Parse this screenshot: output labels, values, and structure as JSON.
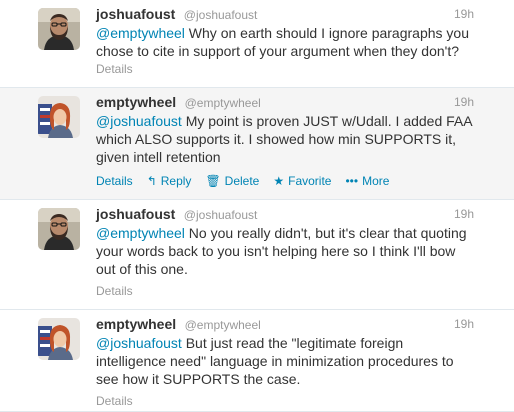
{
  "tweets": [
    {
      "fullname": "joshuafoust",
      "handle": "@joshuafoust",
      "time": "19h",
      "mention": "@emptywheel",
      "text": " Why on earth should I ignore paragraphs you\nchose to cite in support of your argument when they don't?",
      "details": "Details",
      "avatar": "bearded-man-glasses"
    },
    {
      "fullname": "emptywheel",
      "handle": "@emptywheel",
      "time": "19h",
      "mention": "@joshuafoust",
      "text": " My point is proven JUST w/Udall. I added FAA\nwhich ALSO supports it. I showed how min SUPPORTS it,\ngiven intell retention",
      "details": "Details",
      "actions": {
        "reply": "Reply",
        "delete": "Delete",
        "favorite": "Favorite",
        "more": "More"
      },
      "avatar": "red-haired-woman-flag"
    },
    {
      "fullname": "joshuafoust",
      "handle": "@joshuafoust",
      "time": "19h",
      "mention": "@emptywheel",
      "text": " No you really didn't, but it's clear that quoting\nyour words back to you isn't helping here so I think I'll bow\nout of this one.",
      "details": "Details",
      "avatar": "bearded-man-glasses"
    },
    {
      "fullname": "emptywheel",
      "handle": "@emptywheel",
      "time": "19h",
      "mention": "@joshuafoust",
      "text": " But just read the \"legitimate foreign\nintelligence need\" language in minimization procedures to\nsee how it SUPPORTS the case.",
      "details": "Details",
      "avatar": "red-haired-woman-flag"
    }
  ],
  "colors": {
    "link": "#0084b4",
    "muted": "#999999",
    "text": "#333333",
    "hover_bg": "#f5f5f5"
  }
}
